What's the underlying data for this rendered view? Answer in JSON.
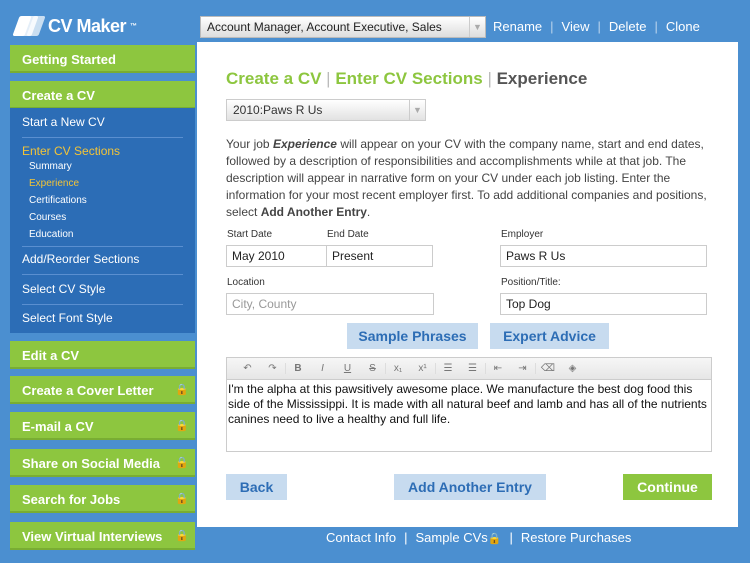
{
  "app": {
    "logo": "CV Maker",
    "logo_tm": "™"
  },
  "header": {
    "cv_select": "Account Manager, Account Executive, Sales",
    "links": [
      "Rename",
      "View",
      "Delete",
      "Clone"
    ]
  },
  "sidebar": {
    "getting_started": "Getting Started",
    "create_cv": "Create a CV",
    "sub": {
      "start_new": "Start a New CV",
      "enter_sections": "Enter CV Sections",
      "sections": [
        "Summary",
        "Experience",
        "Certifications",
        "Courses",
        "Education"
      ],
      "add_reorder": "Add/Reorder Sections",
      "select_style": "Select CV Style",
      "select_font": "Select Font Style"
    },
    "items": [
      {
        "label": "Edit a CV",
        "locked": false
      },
      {
        "label": "Create a Cover Letter",
        "locked": true
      },
      {
        "label": "E-mail a CV",
        "locked": true
      },
      {
        "label": "Share on Social Media",
        "locked": true
      },
      {
        "label": "Search for Jobs",
        "locked": true
      },
      {
        "label": "View Virtual Interviews",
        "locked": true
      }
    ]
  },
  "main": {
    "breadcrumb": [
      "Create a CV",
      "Enter CV Sections",
      "Experience"
    ],
    "entry_select": "2010:Paws R Us",
    "desc_1": "Your job ",
    "desc_em": "Experience",
    "desc_2": " will appear on your CV with the company name, start and end dates, followed by a description of responsibilities and accomplishments while at that job. The description will appear in narrative form on your CV under each job listing. Enter the information for your most recent employer first. To add additional companies and positions, select ",
    "desc_strong": "Add Another Entry",
    "desc_3": ".",
    "start_label": "Start Date",
    "start_value": "May 2010",
    "end_label": "End Date",
    "end_value": "Present",
    "employer_label": "Employer",
    "employer_value": "Paws R Us",
    "location_label": "Location",
    "location_placeholder": "City, County",
    "position_label": "Position/Title:",
    "position_value": "Top Dog",
    "sample_phrases": "Sample Phrases",
    "expert_advice": "Expert Advice",
    "editor_text": "I'm the alpha at this pawsitively awesome place. We manufacture the best dog food this side of the Mississippi. It is made with all natural beef and lamb and has all of the nutrients canines need to live a healthy and full life.",
    "back": "Back",
    "add_entry": "Add Another Entry",
    "continue": "Continue"
  },
  "footer": {
    "contact": "Contact Info",
    "samples": "Sample CVs",
    "restore": "Restore Purchases"
  },
  "colors": {
    "background": "#4b8fd0",
    "green": "#8dc63f",
    "submenu": "#2c6db6",
    "active_link": "#f3c437"
  }
}
